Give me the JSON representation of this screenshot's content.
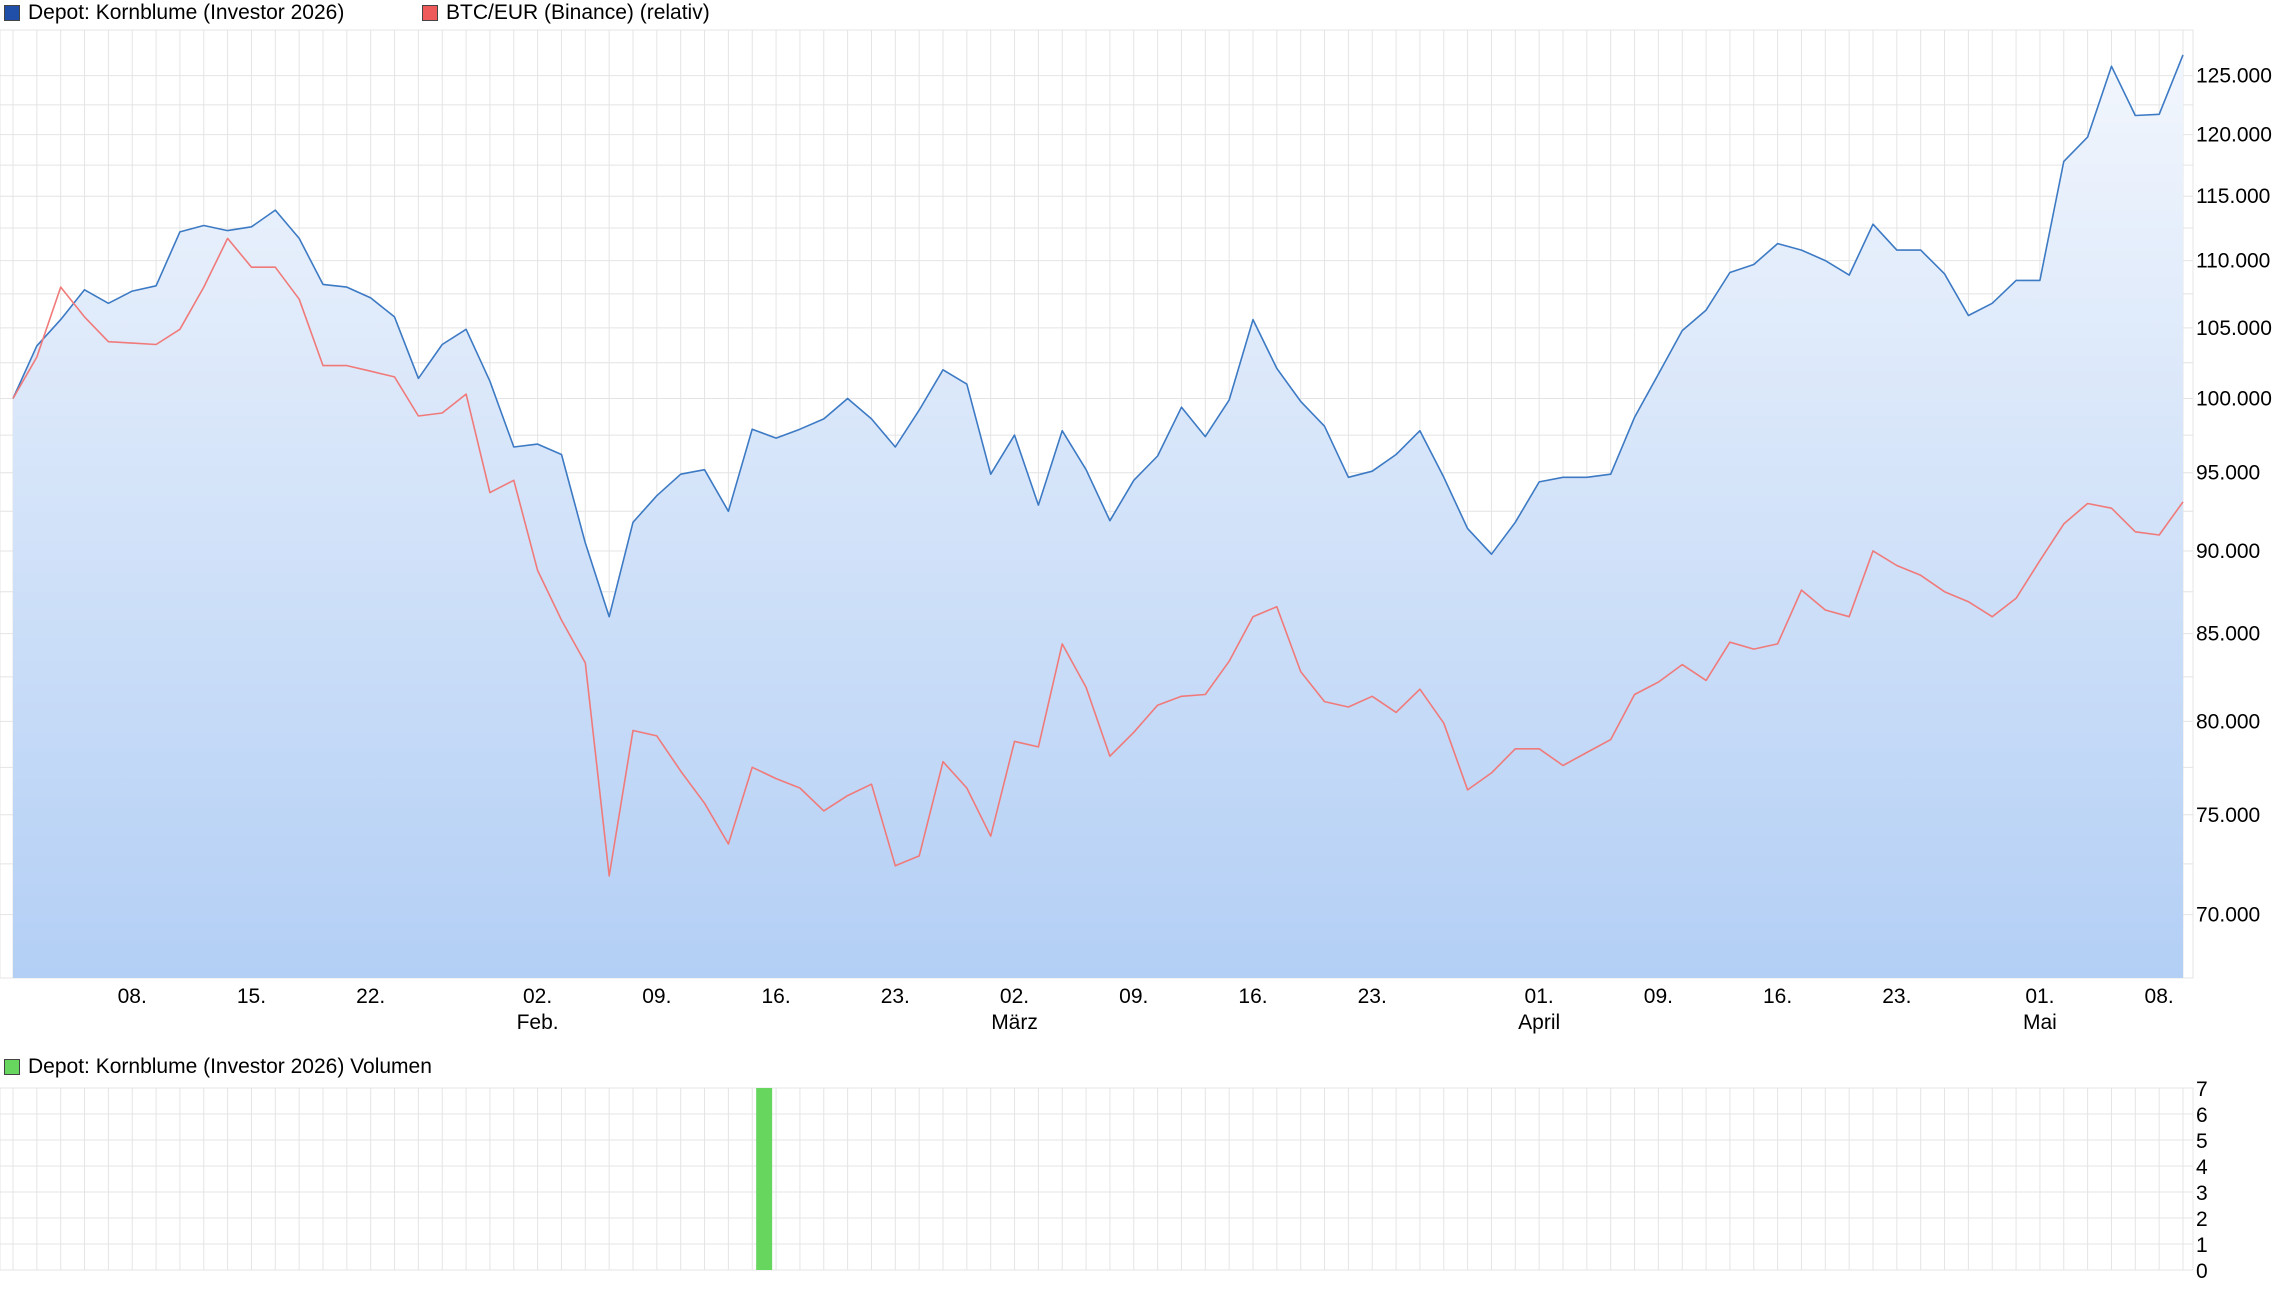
{
  "legend": {
    "depot": "Depot: Kornblume (Investor 2026)",
    "btc": "BTC/EUR (Binance) (relativ)",
    "volume": "Depot: Kornblume (Investor 2026) Volumen"
  },
  "colors": {
    "depot_line": "#3d7ac4",
    "depot_swatch": "#1f4fa8",
    "depot_fill_top": "#f2f6fd",
    "depot_fill_bottom": "#b3cff5",
    "btc_line": "#f07a7a",
    "btc_swatch": "#ee5a5a",
    "volume_bar": "#66d65e",
    "grid": "#e4e4e4"
  },
  "chart_data": [
    {
      "type": "area",
      "y_scale": "log",
      "grid": true,
      "legend_position": "top-left",
      "ylim": [
        67000,
        129000
      ],
      "y_ticks": [
        {
          "value": 70000,
          "label": "70.000"
        },
        {
          "value": 75000,
          "label": "75.000"
        },
        {
          "value": 80000,
          "label": "80.000"
        },
        {
          "value": 85000,
          "label": "85.000"
        },
        {
          "value": 90000,
          "label": "90.000"
        },
        {
          "value": 95000,
          "label": "95.000"
        },
        {
          "value": 100000,
          "label": "100.000"
        },
        {
          "value": 105000,
          "label": "105.000"
        },
        {
          "value": 110000,
          "label": "110.000"
        },
        {
          "value": 115000,
          "label": "115.000"
        },
        {
          "value": 120000,
          "label": "120.000"
        },
        {
          "value": 125000,
          "label": "125.000"
        }
      ],
      "x_ticks": [
        {
          "index": 5,
          "label": "08.",
          "sublabel": ""
        },
        {
          "index": 10,
          "label": "15.",
          "sublabel": ""
        },
        {
          "index": 15,
          "label": "22.",
          "sublabel": ""
        },
        {
          "index": 22,
          "label": "02.",
          "sublabel": "Feb."
        },
        {
          "index": 27,
          "label": "09.",
          "sublabel": ""
        },
        {
          "index": 32,
          "label": "16.",
          "sublabel": ""
        },
        {
          "index": 37,
          "label": "23.",
          "sublabel": ""
        },
        {
          "index": 42,
          "label": "02.",
          "sublabel": "März"
        },
        {
          "index": 47,
          "label": "09.",
          "sublabel": ""
        },
        {
          "index": 52,
          "label": "16.",
          "sublabel": ""
        },
        {
          "index": 57,
          "label": "23.",
          "sublabel": ""
        },
        {
          "index": 64,
          "label": "01.",
          "sublabel": "April"
        },
        {
          "index": 69,
          "label": "09.",
          "sublabel": ""
        },
        {
          "index": 74,
          "label": "16.",
          "sublabel": ""
        },
        {
          "index": 79,
          "label": "23.",
          "sublabel": ""
        },
        {
          "index": 85,
          "label": "01.",
          "sublabel": "Mai"
        },
        {
          "index": 90,
          "label": "08.",
          "sublabel": ""
        }
      ],
      "series": [
        {
          "name": "Depot: Kornblume (Investor 2026)",
          "values": [
            100000,
            103700,
            105600,
            107800,
            106800,
            107700,
            108100,
            112200,
            112700,
            112300,
            112600,
            113900,
            111700,
            108200,
            108000,
            107200,
            105800,
            101400,
            103800,
            104900,
            101200,
            96700,
            96900,
            96200,
            90500,
            86000,
            91800,
            93500,
            94900,
            95200,
            92500,
            97900,
            97300,
            97900,
            98600,
            100000,
            98600,
            96700,
            99200,
            102000,
            101000,
            94900,
            97500,
            92900,
            97800,
            95200,
            91900,
            94500,
            96100,
            99400,
            97400,
            99900,
            105600,
            102100,
            99800,
            98100,
            94700,
            95100,
            96200,
            97800,
            94700,
            91400,
            89800,
            91800,
            94400,
            94700,
            94700,
            94900,
            98700,
            101700,
            104800,
            106300,
            109100,
            109700,
            111300,
            110800,
            110000,
            108900,
            112800,
            110800,
            110800,
            109000,
            105900,
            106800,
            108500,
            108500,
            117800,
            119800,
            125800,
            121600,
            121700,
            126800
          ]
        },
        {
          "name": "BTC/EUR (Binance) (relativ)",
          "values": [
            100000,
            102900,
            108000,
            105800,
            104000,
            103900,
            103800,
            104900,
            108000,
            111700,
            109500,
            109500,
            107100,
            102300,
            102300,
            101900,
            101500,
            98800,
            99000,
            100300,
            93700,
            94500,
            88800,
            85800,
            83300,
            71900,
            79500,
            79200,
            77300,
            75600,
            73500,
            77500,
            76900,
            76400,
            75200,
            76000,
            76600,
            72400,
            72900,
            77800,
            76400,
            73900,
            78900,
            78600,
            84400,
            81900,
            78100,
            79400,
            80900,
            81400,
            81500,
            83400,
            86000,
            86600,
            82800,
            81100,
            80800,
            81400,
            80500,
            81800,
            79900,
            76300,
            77200,
            78500,
            78500,
            77600,
            78300,
            79000,
            81500,
            82200,
            83200,
            82300,
            84500,
            84100,
            84400,
            87600,
            86400,
            86000,
            90000,
            89100,
            88500,
            87500,
            86900,
            86000,
            87100,
            89400,
            91700,
            93000,
            92700,
            91200,
            91000,
            93100
          ]
        }
      ]
    },
    {
      "type": "bar",
      "name": "Depot: Kornblume (Investor 2026) Volumen",
      "ylim": [
        0,
        7
      ],
      "y_ticks": [
        "0",
        "1",
        "2",
        "3",
        "4",
        "5",
        "6",
        "7"
      ],
      "bars": [
        {
          "index": 31,
          "value": 7
        }
      ]
    }
  ]
}
